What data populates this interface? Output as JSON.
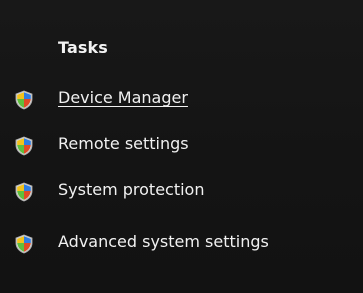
{
  "tasks_panel": {
    "heading": "Tasks",
    "items": [
      {
        "label": "Device Manager",
        "icon": "uac-shield-icon",
        "state": "hover-underlined"
      },
      {
        "label": "Remote settings",
        "icon": "uac-shield-icon"
      },
      {
        "label": "System protection",
        "icon": "uac-shield-icon"
      },
      {
        "label": "Advanced system settings",
        "icon": "uac-shield-icon"
      }
    ]
  },
  "colors": {
    "background": "#151515",
    "text": "#f1f1f1",
    "shield_blue": "#2f7de1",
    "shield_yellow": "#f2c21b",
    "shield_red": "#e04a25",
    "shield_green": "#5fbf3c"
  }
}
